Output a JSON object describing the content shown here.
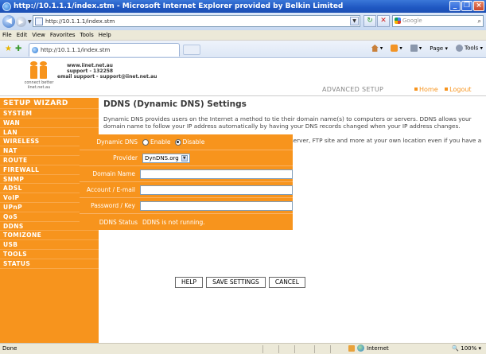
{
  "window": {
    "title": "http://10.1.1.1/index.stm - Microsoft Internet Explorer provided by Belkin Limited",
    "min": "_",
    "max": "❐",
    "close": "×"
  },
  "addressbar": {
    "url": "http://10.1.1.1/index.stm",
    "search_placeholder": "Google"
  },
  "menu": [
    "File",
    "Edit",
    "View",
    "Favorites",
    "Tools",
    "Help"
  ],
  "tabbar": {
    "tab_title": "http://10.1.1.1/index.stm",
    "page_label": "Page",
    "tools_label": "Tools"
  },
  "header": {
    "logo_caption_1": "connect better",
    "logo_caption_2": "iinet.net.au",
    "website": "www.iinet.net.au",
    "support": "support - 132258",
    "email_support": "email support - support@iinet.net.au",
    "section": "ADVANCED SETUP",
    "link_home": "Home",
    "link_logout": "Logout"
  },
  "sidebar": {
    "items": [
      "SETUP WIZARD",
      "SYSTEM",
      "WAN",
      "LAN",
      "WIRELESS",
      "NAT",
      "ROUTE",
      "FIREWALL",
      "SNMP",
      "ADSL",
      "VoIP",
      "UPnP",
      "QoS",
      "DDNS",
      "TOMIZONE",
      "USB",
      "TOOLS",
      "STATUS"
    ]
  },
  "main": {
    "title": "DDNS (Dynamic DNS) Settings",
    "para1": "Dynamic DNS provides users on the Internet a method to tie their domain name(s) to computers or servers. DDNS allows your domain name to follow your IP address automatically by having your DNS records changed when your IP address changes.",
    "para2": "With a DDNS connection you can host your own web site, email server, FTP site and more at your own location even if you have a dynamic IP address."
  },
  "form": {
    "dynamic_dns_label": "Dynamic DNS",
    "enable_label": "Enable",
    "disable_label": "Disable",
    "selected": "Disable",
    "provider_label": "Provider",
    "provider_value": "DynDNS.org",
    "domain_label": "Domain Name",
    "domain_value": "",
    "account_label": "Account / E-mail",
    "account_value": "",
    "password_label": "Password / Key",
    "password_value": "",
    "status_label": "DDNS Status",
    "status_value": "DDNS is not running."
  },
  "buttons": {
    "help": "HELP",
    "save": "SAVE SETTINGS",
    "cancel": "CANCEL"
  },
  "statusbar": {
    "status": "Done",
    "zone": "Internet",
    "zoom": "100%"
  }
}
